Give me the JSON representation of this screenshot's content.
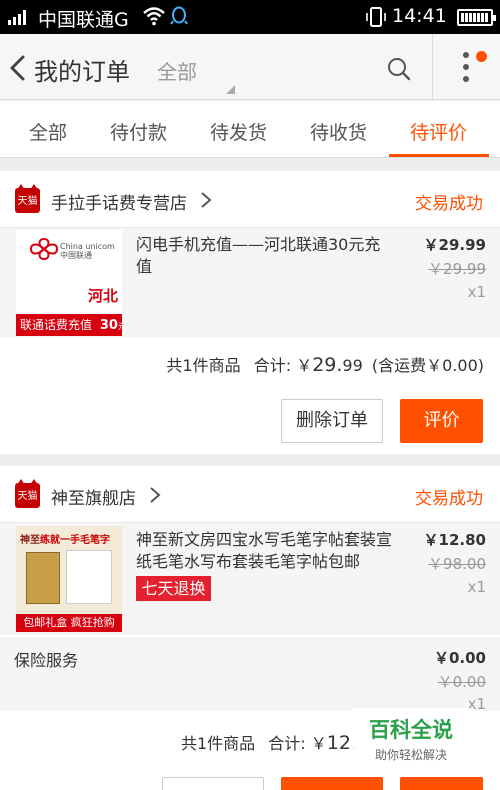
{
  "status_bar": {
    "carrier": "中国联通G",
    "time": "14:41",
    "icons": [
      "signal-icon",
      "wifi-icon",
      "qq-icon",
      "phone-vibrate-icon",
      "battery-icon"
    ]
  },
  "header": {
    "title": "我的订单",
    "filter_label": "全部",
    "icons": [
      "back-icon",
      "search-icon",
      "more-icon"
    ]
  },
  "tabs": [
    {
      "label": "全部"
    },
    {
      "label": "待付款"
    },
    {
      "label": "待发货"
    },
    {
      "label": "待收货"
    },
    {
      "label": "待评价",
      "active": true
    }
  ],
  "orders": [
    {
      "shop_name": "手拉手话费专营店",
      "shop_badge": "天猫",
      "status": "交易成功",
      "item": {
        "title": "闪电手机充值——河北联通30元充值",
        "price": "￥29.99",
        "original_price": "￥29.99",
        "qty": "x1",
        "thumb": {
          "brand": "China unicom中国联通",
          "region": "河北",
          "caption": "联通话费充值",
          "amount": "30",
          "unit": "元"
        }
      },
      "summary": {
        "count_text": "共1件商品",
        "total_label": "合计: ",
        "total_currency": "￥",
        "total_value": "29.",
        "total_cents": "99",
        "shipping": "(含运费￥0.00)"
      },
      "buttons": {
        "delete": "删除订单",
        "review": "评价"
      }
    },
    {
      "shop_name": "神至旗舰店",
      "shop_badge": "天猫",
      "status": "交易成功",
      "item": {
        "title": "神至新文房四宝水写毛笔字帖套装宣纸毛笔水写布套装毛笔字帖包邮",
        "price": "￥12.80",
        "original_price": "￥98.00",
        "qty": "x1",
        "tag": "七天退换",
        "thumb": {
          "logo": "神至",
          "headline": "练就一手毛笔字",
          "banner": "包邮礼盒 疯狂抢购"
        }
      },
      "insurance": {
        "label": "保险服务",
        "price": "￥0.00",
        "original_price": "￥0.00",
        "qty": "x1"
      },
      "summary": {
        "count_text": "共1件商品",
        "total_label": "合计: ",
        "total_currency": "￥",
        "total_value": "12."
      }
    }
  ],
  "watermark": {
    "title": "百科全说",
    "subtitle": "助你轻松解决"
  },
  "colors": {
    "accent": "#ff5000",
    "tmall_red": "#c40000",
    "tag_red": "#e5212f",
    "watermark_green": "#2aa04a"
  }
}
